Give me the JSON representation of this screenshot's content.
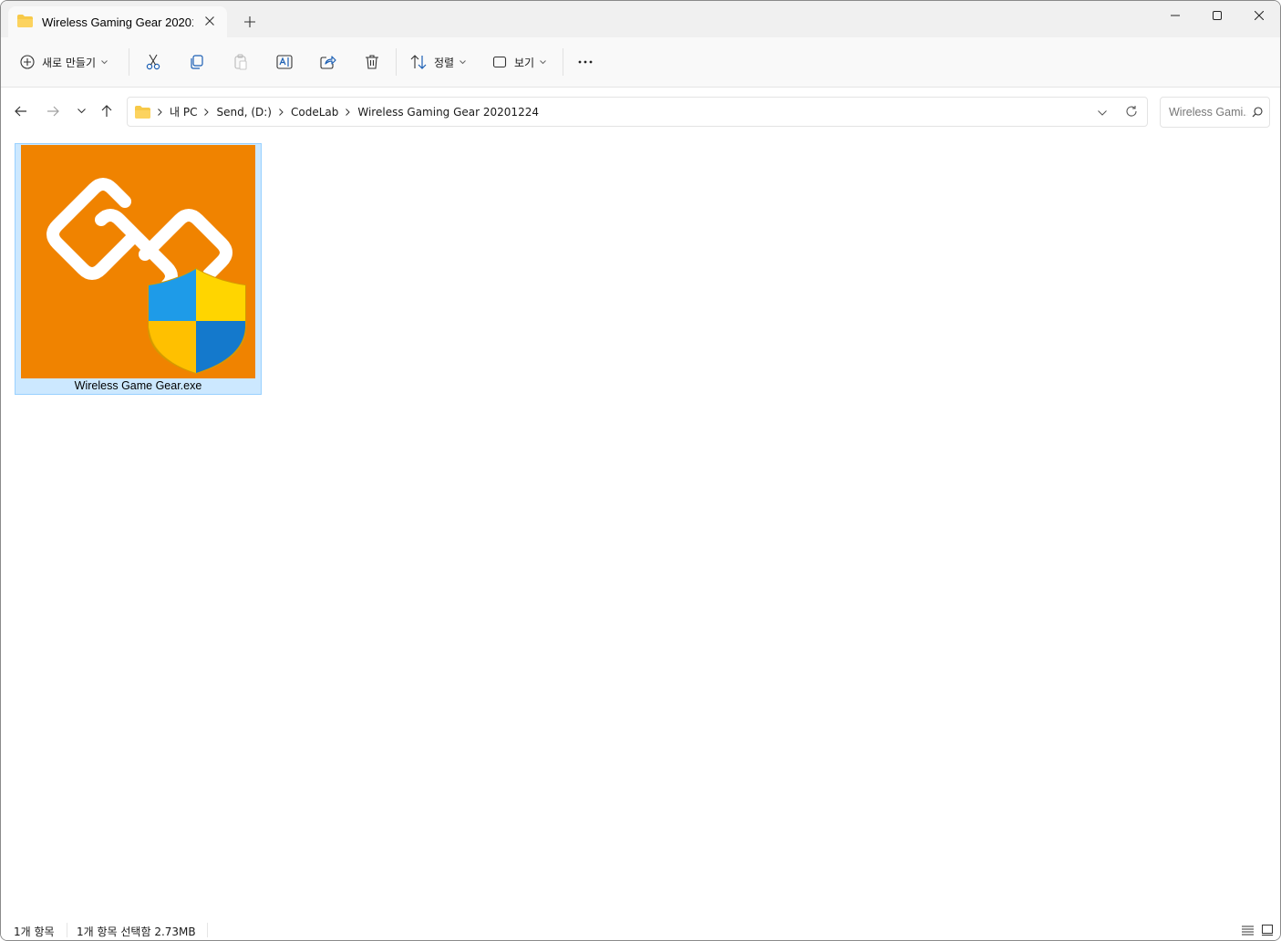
{
  "window": {
    "tab_title": "Wireless Gaming Gear 20201224",
    "icons": {
      "tab": "folder-icon",
      "close_tab": "close-icon",
      "new_tab": "plus-icon",
      "minimize": "minimize-icon",
      "maximize": "maximize-icon",
      "close": "close-icon"
    }
  },
  "toolbar": {
    "new_label": "새로 만들기",
    "sort_label": "정렬",
    "view_label": "보기",
    "icons": [
      "plus-circle-icon",
      "cut-icon",
      "copy-icon",
      "paste-icon",
      "rename-icon",
      "share-icon",
      "delete-icon",
      "sort-icon",
      "view-icon",
      "more-icon"
    ]
  },
  "address": {
    "breadcrumbs": [
      "내 PC",
      "Send, (D:)",
      "CodeLab",
      "Wireless Gaming Gear 20201224"
    ],
    "search_placeholder": "Wireless Gami..."
  },
  "files": [
    {
      "name": "Wireless Game Gear.exe",
      "selected": true,
      "thumb_color": "#f08300"
    }
  ],
  "status": {
    "count": "1개 항목",
    "selected": "1개 항목 선택함 2.73MB"
  },
  "colors": {
    "accent": "#0067c0",
    "selection_bg": "#cce8ff",
    "selection_border": "#99d1ff"
  }
}
